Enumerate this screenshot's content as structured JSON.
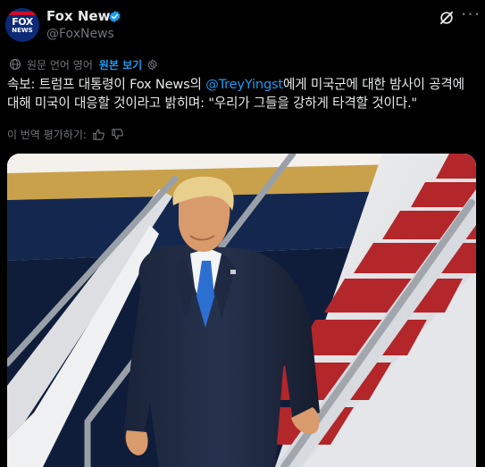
{
  "author": {
    "name": "Fox News",
    "handle": "@FoxNews",
    "avatar_text_top": "FOX",
    "avatar_text_bottom": "NEWS",
    "verified_icon": "verified-badge-icon"
  },
  "header_actions": {
    "grok_icon": "grok-icon",
    "more_label": "···"
  },
  "translation": {
    "language_note": "원문 언어 영어",
    "show_original": "원본 보기",
    "rate_prompt": "이 번역 평가하기:"
  },
  "tweet": {
    "text_before_mention": "속보: 트럼프 대통령이 Fox News의 ",
    "mention": "@TreyYingst",
    "text_after_mention": "에게 미국군에 대한 밤사이 공격에 대해 미국이 대응할 것이라고 밝히며: \"우리가 그들을 강하게 타격할 것이다.\""
  },
  "colors": {
    "background": "#000000",
    "accent": "#1d9bf0",
    "muted": "#71767b",
    "text": "#e7e9ea"
  }
}
